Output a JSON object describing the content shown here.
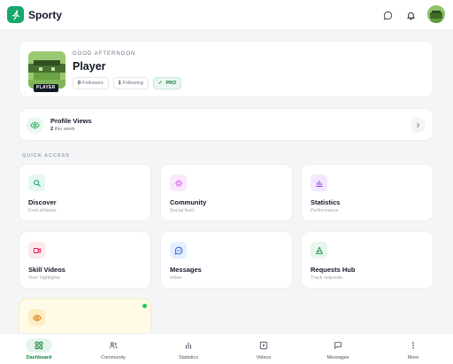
{
  "app": {
    "name": "Sporty",
    "brand_color": "#14a86b"
  },
  "header": {
    "icons": [
      "message-icon",
      "bell-icon",
      "user-avatar"
    ]
  },
  "profile": {
    "greeting": "GOOD AFTERNOON",
    "name": "Player",
    "badge": "PLAYER",
    "followers_count": "0",
    "followers_label": "Followers",
    "following_count": "1",
    "following_label": "Following",
    "pro_label": "PRO"
  },
  "profile_views": {
    "title": "Profile Views",
    "count": "2",
    "period": "this week"
  },
  "quick_access": {
    "label": "QUICK ACCESS",
    "tiles": [
      {
        "title": "Discover",
        "subtitle": "Find athletes",
        "icon": "search-icon",
        "color": "#0f9f7a",
        "bg": "#e6f7f1"
      },
      {
        "title": "Community",
        "subtitle": "Social feed",
        "icon": "sparkle-icon",
        "color": "#d946ef",
        "bg": "#fbe9fb"
      },
      {
        "title": "Statistics",
        "subtitle": "Performance",
        "icon": "bar-chart-icon",
        "color": "#9333ea",
        "bg": "#f3e8ff"
      },
      {
        "title": "Skill Videos",
        "subtitle": "Your highlights",
        "icon": "video-icon",
        "color": "#e11d48",
        "bg": "#fde8ec"
      },
      {
        "title": "Messages",
        "subtitle": "Inbox",
        "icon": "chat-icon",
        "color": "#2563eb",
        "bg": "#e6efff"
      },
      {
        "title": "Requests Hub",
        "subtitle": "Track requests",
        "icon": "triangle-icon",
        "color": "#16a34a",
        "bg": "#e7f7ec"
      }
    ]
  },
  "bottom_nav": [
    {
      "label": "Dashboard",
      "icon": "grid-icon",
      "active": true
    },
    {
      "label": "Community",
      "icon": "users-icon",
      "active": false
    },
    {
      "label": "Statistics",
      "icon": "bars-icon",
      "active": false
    },
    {
      "label": "Videos",
      "icon": "play-icon",
      "active": false
    },
    {
      "label": "Messages",
      "icon": "message-icon",
      "active": false
    },
    {
      "label": "More",
      "icon": "more-icon",
      "active": false
    }
  ]
}
